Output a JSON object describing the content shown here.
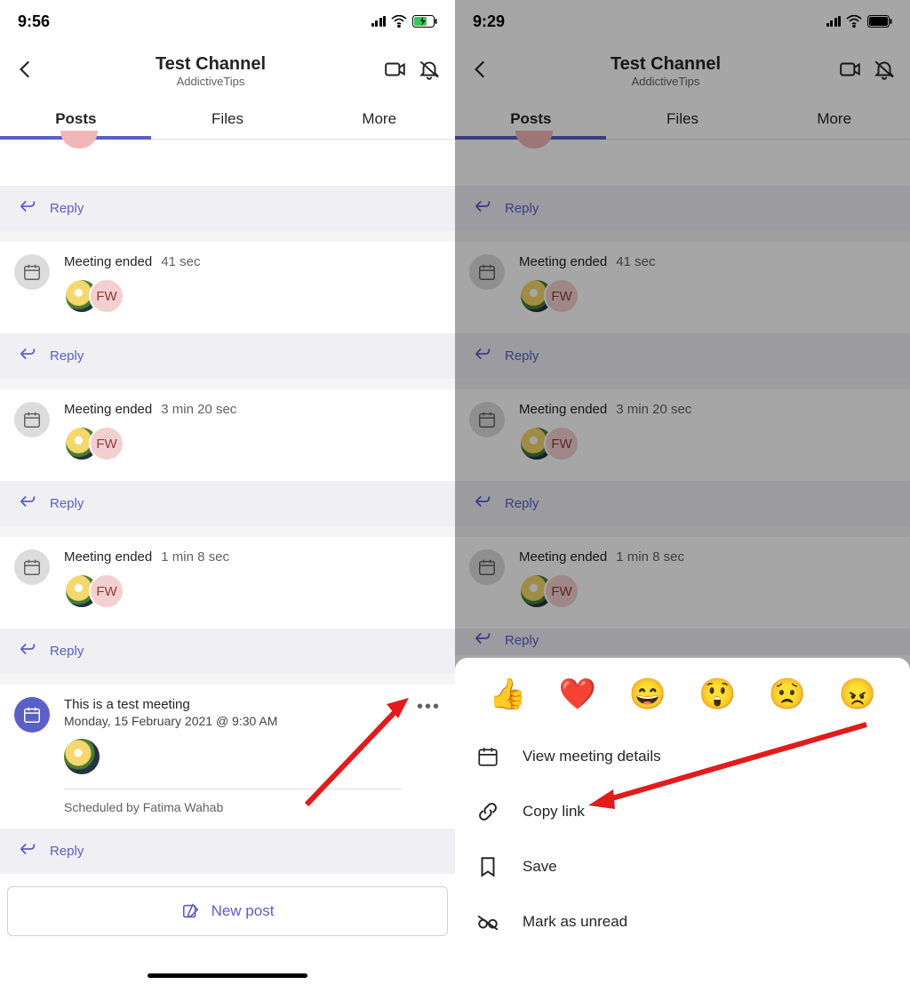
{
  "left": {
    "time": "9:56",
    "battery_color": "#34c759"
  },
  "right": {
    "time": "9:29",
    "battery_color": "#000"
  },
  "header": {
    "title": "Test Channel",
    "subtitle": "AddictiveTips"
  },
  "tabs": [
    "Posts",
    "Files",
    "More"
  ],
  "posts": {
    "meeting_ended_label": "Meeting ended",
    "entries": [
      {
        "duration": "41 sec",
        "initials": "FW"
      },
      {
        "duration": "3 min 20 sec",
        "initials": "FW"
      },
      {
        "duration": "1 min 8 sec",
        "initials": "FW"
      }
    ],
    "reply_label": "Reply"
  },
  "meeting": {
    "title": "This is a test meeting",
    "datetime": "Monday, 15 February 2021 @ 9:30 AM",
    "scheduled_by": "Scheduled by Fatima Wahab"
  },
  "newpost": {
    "label": "New post"
  },
  "sheet": {
    "reactions": [
      "👍",
      "❤️",
      "😄",
      "😲",
      "😟",
      "😠"
    ],
    "items": [
      {
        "icon": "calendar",
        "label": "View meeting details"
      },
      {
        "icon": "link",
        "label": "Copy link"
      },
      {
        "icon": "bookmark",
        "label": "Save"
      },
      {
        "icon": "unread",
        "label": "Mark as unread"
      }
    ]
  }
}
